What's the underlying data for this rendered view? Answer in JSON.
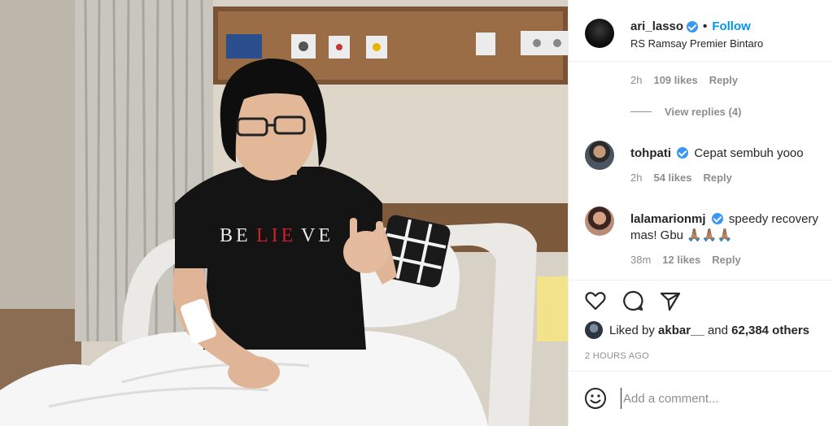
{
  "post": {
    "username": "ari_lasso",
    "separator": "•",
    "follow_label": "Follow",
    "location": "RS Ramsay Premier Bintaro"
  },
  "comments": {
    "first_meta": {
      "time": "2h",
      "likes": "109 likes",
      "reply": "Reply"
    },
    "view_replies": "View replies (4)",
    "items": [
      {
        "username": "tohpati",
        "text": "Cepat sembuh yooo",
        "time": "2h",
        "likes": "54 likes",
        "reply": "Reply"
      },
      {
        "username": "lalamarionmj",
        "text": "speedy recovery mas! Gbu 🙏🏽🙏🏽🙏🏽",
        "time": "38m",
        "likes": "12 likes",
        "reply": "Reply"
      }
    ]
  },
  "actions": {
    "like_icon": "heart-icon",
    "comment_icon": "comment-icon",
    "share_icon": "share-icon",
    "liked_by_prefix": "Liked by",
    "liked_by_user": "akbar__",
    "liked_by_and": "and",
    "liked_by_count": "62,384 others",
    "time_ago": "2 HOURS AGO"
  },
  "add_comment": {
    "placeholder": "Add a comment...",
    "emoji_icon": "smiley-icon"
  },
  "photo": {
    "shirt_text_1": "BE",
    "shirt_text_2": "LIE",
    "shirt_text_3": "VE"
  },
  "colors": {
    "link_blue": "#0095f6",
    "verified_blue": "#3897f0",
    "meta_gray": "#8e8e8e",
    "text_dark": "#262626"
  }
}
